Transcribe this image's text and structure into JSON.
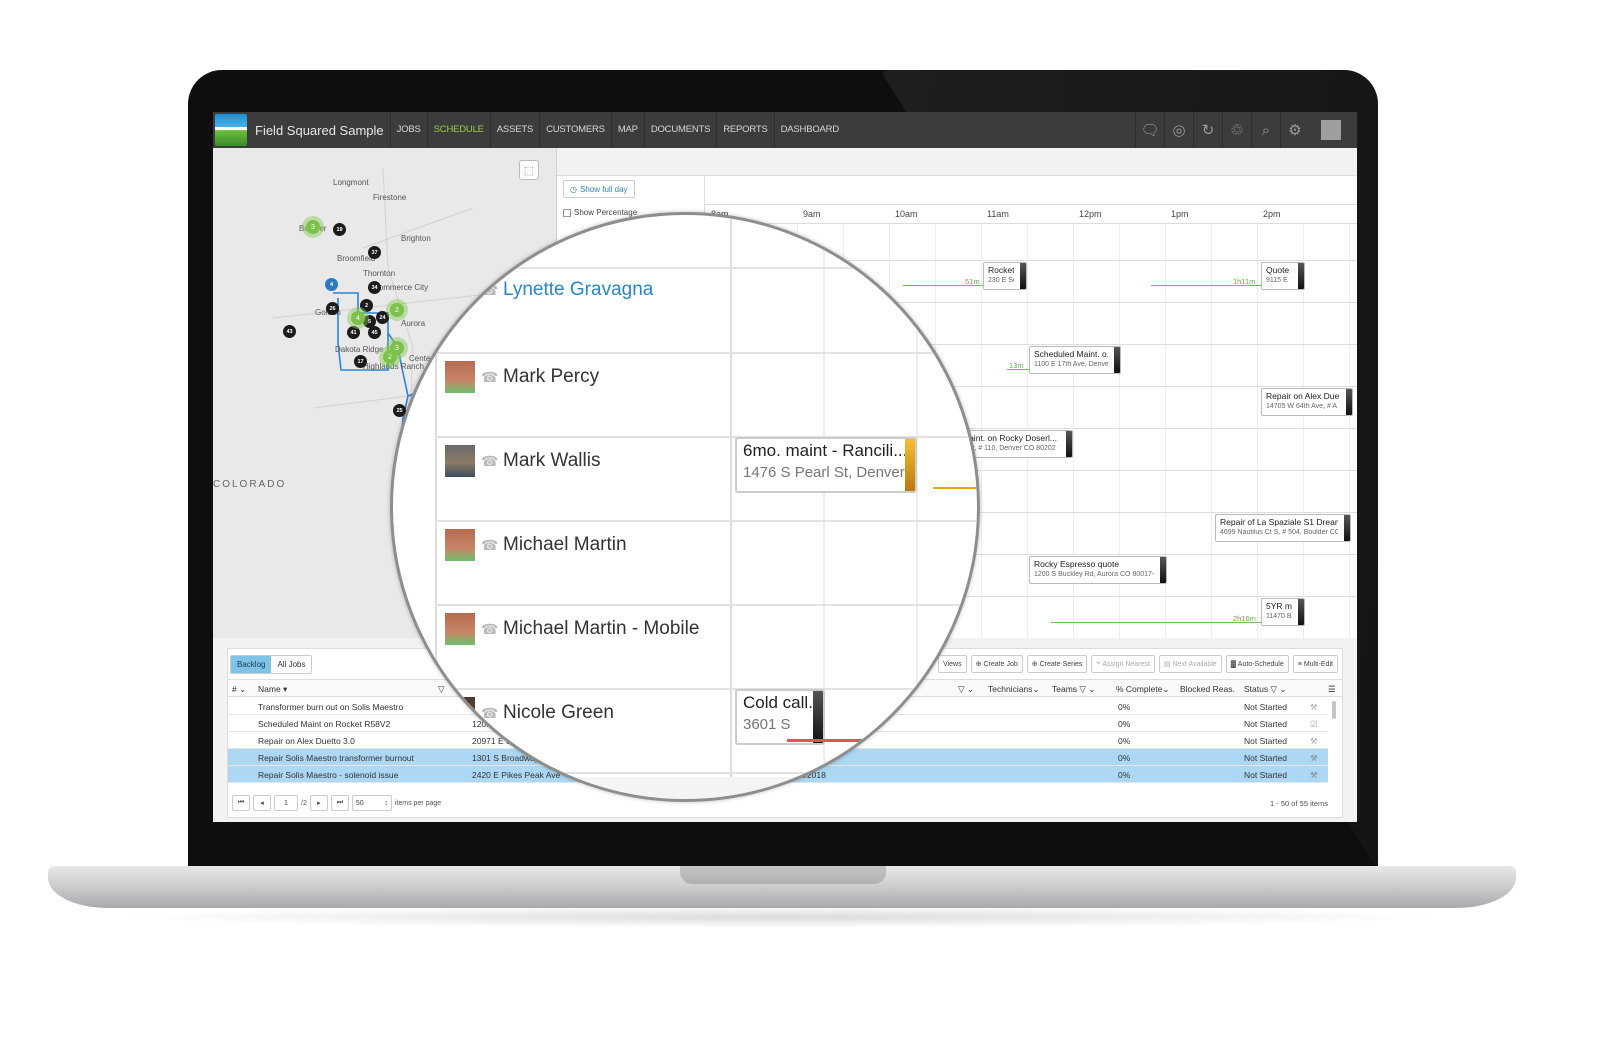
{
  "app": {
    "title": "Field Squared Sample",
    "nav": [
      "JOBS",
      "SCHEDULE",
      "ASSETS",
      "CUSTOMERS",
      "MAP",
      "DOCUMENTS",
      "REPORTS",
      "DASHBOARD"
    ],
    "active_nav": "SCHEDULE",
    "toolbar_icons": [
      "chat-icon",
      "help-lifebuoy-icon",
      "refresh-icon",
      "recycle-icon",
      "search-icon",
      "gear-icon",
      "user-avatar"
    ],
    "accent_color": "#9ccf3c"
  },
  "map": {
    "labels": [
      "Longmont",
      "Firestone",
      "Boulder",
      "Brighton",
      "Broomfield",
      "Thornton",
      "Commerce City",
      "Golden",
      "Aurora",
      "Dakota Ridge",
      "Highlands Ranch",
      "Centennial",
      "COLORADO"
    ],
    "pins": [
      "19",
      "37",
      "34",
      "26",
      "2",
      "24",
      "5",
      "41",
      "45",
      "43",
      "17",
      "25"
    ],
    "blue_pins": [
      "4"
    ],
    "clusters": [
      "3",
      "2",
      "4",
      "2",
      "3"
    ]
  },
  "schedule": {
    "show_full_day": "Show full day",
    "show_percentage": "Show Percentage",
    "hours": [
      "8am",
      "9am",
      "10am",
      "11am",
      "12pm",
      "1pm",
      "2pm"
    ],
    "jobs": [
      {
        "title": "Rocket ...",
        "address": "230 E Sou",
        "travel": "51m"
      },
      {
        "title": "Quote o...",
        "address": "9115 E",
        "travel": "1h11m"
      },
      {
        "title": "Scheduled Maint. o...",
        "address": "1100 E 17th Ave, Denver",
        "travel": "13m"
      },
      {
        "title": "Repair on Alex Due...",
        "address": "14705 W 64th Ave, # A",
        "travel": ""
      },
      {
        "title": "maint. on Rocky Doserl...",
        "address": "n St, # 110, Denver CO 80202",
        "travel": ""
      },
      {
        "title": "Repair of La Spaziale S1 Dream",
        "address": "4699 Nautilus Ct S, # 504, Boulder CO",
        "travel": ""
      },
      {
        "title": "Rocky Espresso quote",
        "address": "1200 S Buckley Rd, Aurora CO 80017-",
        "travel": ""
      },
      {
        "title": "5YR mai...",
        "address": "11470 Bla",
        "travel": "2h16m"
      }
    ]
  },
  "magnifier": {
    "technicians": [
      {
        "name": "Lynette Gravagna",
        "highlighted": true
      },
      {
        "name": "Mark Percy",
        "highlighted": false
      },
      {
        "name": "Mark Wallis",
        "highlighted": false
      },
      {
        "name": "Michael Martin",
        "highlighted": false
      },
      {
        "name": "Michael Martin - Mobile",
        "highlighted": false
      },
      {
        "name": "Nicole Green",
        "highlighted": false
      }
    ],
    "jobs": [
      {
        "title": "6mo. maint - Rancili...",
        "address": "1476 S Pearl St, Denver",
        "color": "#e8a317"
      },
      {
        "title": "Cold call...",
        "address": "3601 S",
        "color": "#333333"
      }
    ]
  },
  "grid": {
    "tabs": [
      "Backlog",
      "All Jobs"
    ],
    "active_tab": "Backlog",
    "toolbar": [
      "Views",
      "Create Job",
      "Create Series",
      "Assign Nearest",
      "Next Available",
      "Auto-Schedule",
      "Multi-Edit"
    ],
    "columns": [
      "#",
      "Name",
      "Technicians",
      "Teams",
      "% Complete",
      "Blocked Reas.",
      "Status"
    ],
    "rows": [
      {
        "name": "Transformer burn out on Solis Maestro",
        "address": "",
        "date": "",
        "complete": "0%",
        "status": "Not Started",
        "icon": "wrench-icon",
        "selected": false
      },
      {
        "name": "Scheduled Maint on Rocket R58V2",
        "address": "120...",
        "date": "",
        "complete": "0%",
        "status": "Not Started",
        "icon": "checklist-icon",
        "selected": false
      },
      {
        "name": "Repair on Alex Duetto 3.0",
        "address": "20971 E S...",
        "date": "",
        "complete": "0%",
        "status": "Not Started",
        "icon": "wrench-icon",
        "selected": false
      },
      {
        "name": "Repair Solis Maestro transformer burnout",
        "address": "1301 S Broadway",
        "date": "",
        "complete": "0%",
        "status": "Not Started",
        "icon": "wrench-icon",
        "selected": true
      },
      {
        "name": "Repair Solis Maestro - solenoid issue",
        "address": "2420 E Pikes Peak Ave",
        "date": "2/24/2018",
        "complete": "0%",
        "status": "Not Started",
        "icon": "wrench-icon",
        "selected": true
      }
    ],
    "pager": {
      "page": "1",
      "total_pages": "/2",
      "page_size": "50",
      "items_per_page": "items per page",
      "summary": "1 - 50 of 55 items"
    }
  }
}
